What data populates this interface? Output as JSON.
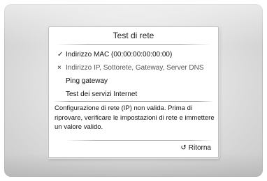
{
  "dialog": {
    "title": "Test di rete",
    "tests": [
      {
        "status": "passed",
        "icon": "checkmark-icon",
        "symbol": "✓",
        "label": "Indirizzo MAC (00:00:00:00:00:00)"
      },
      {
        "status": "failed",
        "icon": "cross-icon",
        "symbol": "×",
        "label": "Indirizzo IP, Sottorete, Gateway, Server DNS"
      },
      {
        "status": "pending",
        "icon": "",
        "symbol": "",
        "label": "Ping gateway"
      },
      {
        "status": "pending",
        "icon": "",
        "symbol": "",
        "label": "Test dei servizi Internet"
      }
    ],
    "message": "Configurazione di rete (IP) non valida. Prima di riprovare, verificare le impostazioni di rete e immettere un valore valido.",
    "return_button": {
      "icon": "return-arrow-icon",
      "symbol": "↺",
      "label": "Ritorna"
    }
  }
}
